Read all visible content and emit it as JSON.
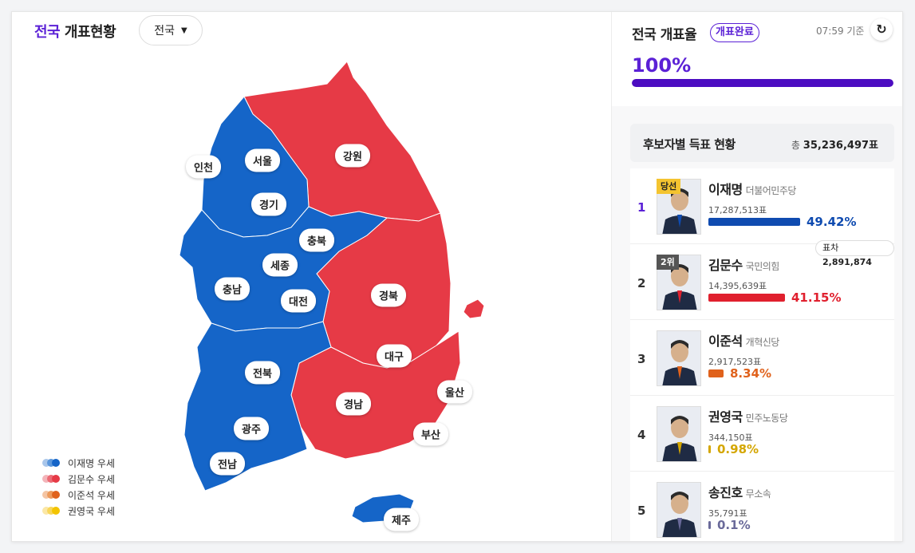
{
  "header": {
    "title_accent": "전국",
    "title_rest": " 개표현황",
    "region_select": "전국"
  },
  "map": {
    "labels": [
      "인천",
      "서울",
      "경기",
      "강원",
      "충북",
      "세종",
      "충남",
      "대전",
      "경북",
      "대구",
      "울산",
      "전북",
      "경남",
      "광주",
      "부산",
      "전남",
      "제주"
    ],
    "colors": {
      "lee": "#1565c8",
      "kim": "#e63a46"
    }
  },
  "legend": [
    {
      "label": "이재명 우세",
      "colors": [
        "#a9c6ea",
        "#5b97dc",
        "#1565c8"
      ]
    },
    {
      "label": "김문수 우세",
      "colors": [
        "#f3b4b9",
        "#ec6b75",
        "#e63a46"
      ]
    },
    {
      "label": "이준석 우세",
      "colors": [
        "#f4c5a4",
        "#ec9a5c",
        "#e0621c"
      ]
    },
    {
      "label": "권영국 우세",
      "colors": [
        "#fbe7a6",
        "#f8d65a",
        "#f3c400"
      ]
    }
  ],
  "rate": {
    "title": "전국 개표율",
    "badge": "개표완료",
    "time": "07:59 기준",
    "value": "100%",
    "fill": 1.0
  },
  "candidates_header": {
    "title": "후보자별 득표 현황",
    "total_prefix": "총",
    "total": "35,236,497표"
  },
  "gap": {
    "label": "표차",
    "value": "2,891,874"
  },
  "candidates": [
    {
      "rank": "1",
      "status": "당선",
      "name": "이재명",
      "party": "더불어민주당",
      "votes": "17,287,513표",
      "pct": "49.42%",
      "share": 0.4942,
      "color": "#0f4bb0"
    },
    {
      "rank": "2",
      "status": "2위",
      "name": "김문수",
      "party": "국민의힘",
      "votes": "14,395,639표",
      "pct": "41.15%",
      "share": 0.4115,
      "color": "#e0202e"
    },
    {
      "rank": "3",
      "status": "",
      "name": "이준석",
      "party": "개혁신당",
      "votes": "2,917,523표",
      "pct": "8.34%",
      "share": 0.0834,
      "color": "#e0621c"
    },
    {
      "rank": "4",
      "status": "",
      "name": "권영국",
      "party": "민주노동당",
      "votes": "344,150표",
      "pct": "0.98%",
      "share": 0.0098,
      "color": "#d4a600"
    },
    {
      "rank": "5",
      "status": "",
      "name": "송진호",
      "party": "무소속",
      "votes": "35,791표",
      "pct": "0.1%",
      "share": 0.001,
      "color": "#6a6a9a"
    }
  ]
}
